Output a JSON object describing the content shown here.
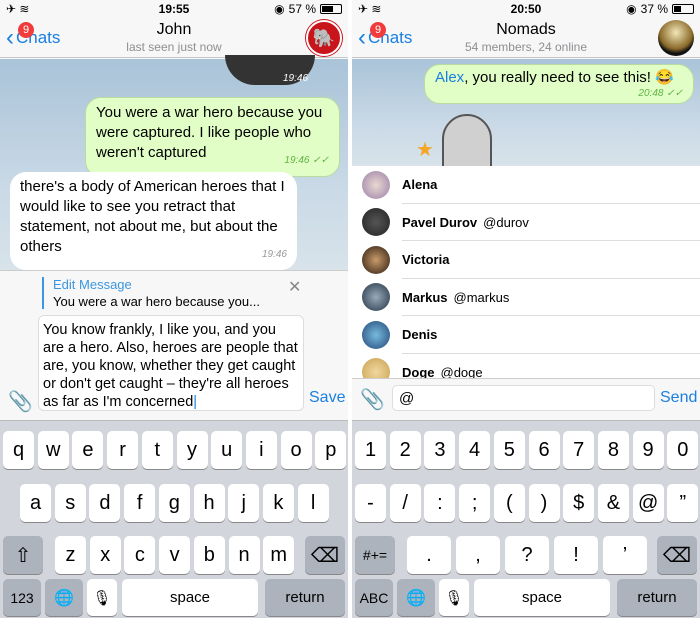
{
  "left": {
    "status": {
      "time": "19:55",
      "battery": "57 %",
      "battery_level": 57
    },
    "nav": {
      "back": "Chats",
      "badge": "9",
      "title": "John",
      "subtitle": "last seen just now"
    },
    "messages": [
      {
        "type": "outgoing",
        "text": "You were a war hero because you were captured. I like people who weren't captured",
        "time": "19:46",
        "status": "read"
      },
      {
        "type": "incoming",
        "text": "there's a body of American heroes that I would like to see you retract that statement, not about me, but about the others",
        "time": "19:46"
      }
    ],
    "sticker_time": "19:46",
    "edit": {
      "label": "Edit Message",
      "preview": "You were a war hero because you...",
      "text": "You know frankly, I like you, and you are a hero. Also, heroes are people that are, you know, whether they get caught or don't get caught – they're all heroes as far as I'm concerned",
      "action": "Save"
    },
    "keyboard": {
      "rows": [
        [
          "q",
          "w",
          "e",
          "r",
          "t",
          "y",
          "u",
          "i",
          "o",
          "p"
        ],
        [
          "a",
          "s",
          "d",
          "f",
          "g",
          "h",
          "j",
          "k",
          "l"
        ],
        [
          "z",
          "x",
          "c",
          "v",
          "b",
          "n",
          "m"
        ]
      ],
      "mode": "123",
      "space": "space",
      "return": "return"
    }
  },
  "right": {
    "status": {
      "time": "20:50",
      "battery": "37 %",
      "battery_level": 37
    },
    "nav": {
      "back": "Chats",
      "badge": "9",
      "title": "Nomads",
      "subtitle": "54 members, 24 online"
    },
    "message": {
      "mention": "Alex",
      "text": ", you really need to see this! 😂",
      "time": "20:48",
      "status": "read"
    },
    "mentions": [
      {
        "name": "Alena",
        "username": ""
      },
      {
        "name": "Pavel Durov",
        "username": "@durov"
      },
      {
        "name": "Victoria",
        "username": ""
      },
      {
        "name": "Markus",
        "username": "@markus"
      },
      {
        "name": "Denis",
        "username": ""
      },
      {
        "name": "Doge",
        "username": "@doge"
      }
    ],
    "input": {
      "value": "@",
      "action": "Send"
    },
    "keyboard": {
      "rows": [
        [
          "1",
          "2",
          "3",
          "4",
          "5",
          "6",
          "7",
          "8",
          "9",
          "0"
        ],
        [
          "-",
          "/",
          ":",
          ";",
          "(",
          ")",
          "$",
          "&",
          "@",
          "”"
        ],
        [
          ".",
          ",",
          "?",
          "!",
          "’"
        ]
      ],
      "mode": "ABC",
      "symbols": "#+=",
      "space": "space",
      "return": "return"
    }
  },
  "colors": {
    "accent": "#1a7fe0",
    "outgoing": "#e1fec6",
    "badge": "#f23c3c",
    "keyboard": "#d2d5db"
  }
}
